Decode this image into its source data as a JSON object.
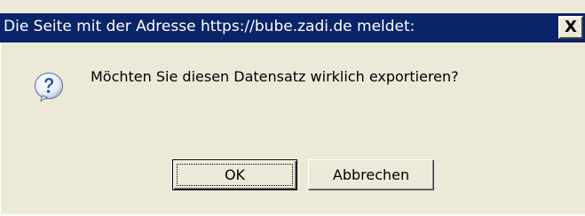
{
  "dialog": {
    "title": "Die Seite mit der Adresse https://bube.zadi.de meldet:",
    "close_label": "X",
    "message": "Möchten Sie diesen Datensatz wirklich exportieren?",
    "icon": "question-icon",
    "buttons": {
      "ok": "OK",
      "cancel": "Abbrechen"
    }
  },
  "colors": {
    "titlebar": "#0a246a",
    "dialog_bg": "#ece9d8",
    "icon_blue": "#1d4fa8"
  }
}
